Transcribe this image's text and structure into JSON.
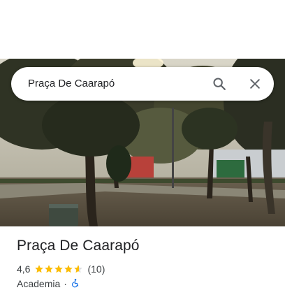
{
  "search": {
    "query": "Praça De Caarapó"
  },
  "icons": {
    "search": "search-icon",
    "close": "close-icon",
    "star": "star-icon",
    "accessibility": "wheelchair-icon"
  },
  "place": {
    "name": "Praça De Caarapó",
    "rating": "4,6",
    "rating_stars": 4.6,
    "review_count": "(10)",
    "category": "Academia",
    "separator": "·"
  },
  "colors": {
    "star": "#fbbc04",
    "star_empty": "#dadce0",
    "text_primary": "#202124",
    "accessibility_icon": "#1a73e8"
  }
}
